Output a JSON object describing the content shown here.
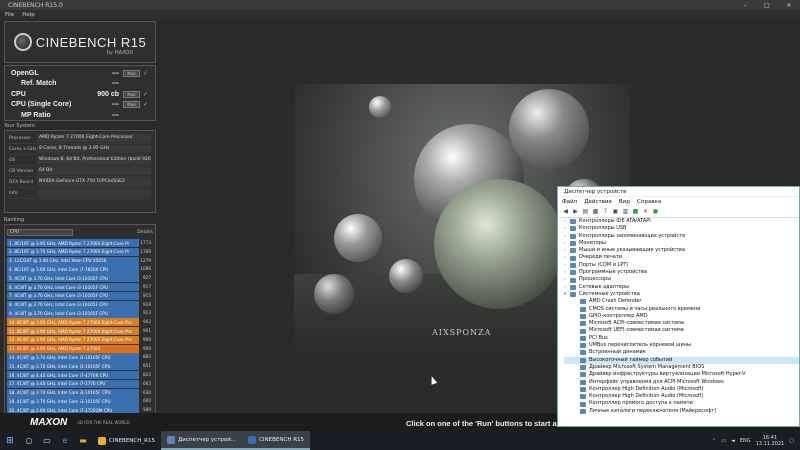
{
  "window": {
    "title": "CINEBENCH R15.0",
    "controls": [
      "–",
      "□",
      "✕"
    ]
  },
  "menu": [
    "File",
    "Help"
  ],
  "logo": {
    "name": "CINEBENCH R15",
    "by": "by MAXON"
  },
  "bench": [
    {
      "label": "OpenGL",
      "value": "---",
      "run": "Run",
      "check": "✓"
    },
    {
      "label": "Ref. Match",
      "value": "---"
    },
    {
      "label": "CPU",
      "value": "900 cb",
      "run": "Run",
      "check": "✓"
    },
    {
      "label": "CPU (Single Core)",
      "value": "---",
      "run": "Run",
      "check": "✓"
    },
    {
      "label": "MP Ratio",
      "value": "---"
    }
  ],
  "system": {
    "header": "Your System",
    "rows": [
      {
        "key": "Processor",
        "value": "AMD Ryzen 7 2700X Eight-Core Processor"
      },
      {
        "key": "Cores x GHz",
        "value": "8 Cores, 8 Threads @ 3.95 GHz"
      },
      {
        "key": "OS",
        "value": "Windows 8, 64 Bit, Professional Edition (build 9200)"
      },
      {
        "key": "CB Version",
        "value": "64 Bit"
      },
      {
        "key": "GFX Board",
        "value": "NVIDIA GeForce GTX 750 Ti/PCIe/SSE2"
      },
      {
        "key": "Info",
        "value": ""
      }
    ]
  },
  "ranking": {
    "header": "Ranking",
    "select": "CPU",
    "details": "Details",
    "rows": [
      {
        "desc": "1. 8C/16T @ 3.95 GHz, AMD Ryzen 7 2700X Eight-Core Pr",
        "score": "1773",
        "color": "#3a6fb0"
      },
      {
        "desc": "2. 8C/16T @ 3.70 GHz, AMD Ryzen 7 2700X Eight-Core Pr",
        "score": "1789",
        "color": "#3a6fb0"
      },
      {
        "desc": "3. 12C/24T @ 3.40 GHz, Intel Xeon CPU X5650",
        "score": "1279",
        "color": "#3a6fb0"
      },
      {
        "desc": "4. 8C/16T @ 3.60 GHz, Intel Core i7-7820X CPU",
        "score": "1086",
        "color": "#3a6fb0"
      },
      {
        "desc": "5. 4C/8T @ 3.70 GHz, Intel Core i3-10105F CPU",
        "score": "927",
        "color": "#3a6fb0"
      },
      {
        "desc": "6. 4C/8T @ 3.70 GHz, Intel Core i3-10105F CPU",
        "score": "917",
        "color": "#3a6fb0"
      },
      {
        "desc": "7. 4C/8T @ 3.70 GHz, Intel Core i3-10105F CPU",
        "score": "915",
        "color": "#3a6fb0"
      },
      {
        "desc": "8. 4C/8T @ 3.70 GHz, Intel Core i3-10105F CPU",
        "score": "916",
        "color": "#3a6fb0"
      },
      {
        "desc": "9. 4C/8T @ 3.70 GHz, Intel Core i3-10105F CPU",
        "score": "913",
        "color": "#3a6fb0"
      },
      {
        "desc": "10. 8C/8T @ 3.95 GHz, AMD Ryzen 7 2700X Eight-Core Pro",
        "score": "902",
        "color": "#d4801e"
      },
      {
        "desc": "11. 8C/8T @ 3.95 GHz, AMD Ryzen 7 2700X Eight-Core Pro",
        "score": "901",
        "color": "#d4801e"
      },
      {
        "desc": "12. 8C/8T @ 3.95 GHz, AMD Ryzen 7 2700X Eight-Core Pro",
        "score": "900",
        "color": "#d4801e"
      },
      {
        "desc": "13. 8C/8T @ 3.95 GHz, AMD Ryzen 7 2700X",
        "score": "900",
        "color": "#e2700e"
      },
      {
        "desc": "14. 4C/8T @ 3.70 GHz, Intel Core i3-10105F CPU",
        "score": "882",
        "color": "#3a6fb0"
      },
      {
        "desc": "15. 4C/8T @ 3.70 GHz, Intel Core i3-10105F CPU",
        "score": "851",
        "color": "#3a6fb0"
      },
      {
        "desc": "16. 4C/8T @ 4.40 GHz, Intel Core i7-4770K CPU",
        "score": "822",
        "color": "#3a6fb0"
      },
      {
        "desc": "17. 4C/8T @ 3.40 GHz, Intel Core i7-3770 CPU",
        "score": "662",
        "color": "#3a6fb0"
      },
      {
        "desc": "18. 4C/8T @ 3.70 GHz, Intel Core i3-10105F CPU",
        "score": "630",
        "color": "#3a6fb0"
      },
      {
        "desc": "19. 4C/8T @ 3.70 GHz, Intel Core i3-10105F CPU",
        "score": "600",
        "color": "#3a6fb0"
      },
      {
        "desc": "20. 4C/8T @ 2.60 GHz, Intel Core i7-3720QM CPU",
        "score": "590",
        "color": "#3a6fb0"
      },
      {
        "desc": "21. 4C/8T @ 2.79 GHz, Intel Core i7-3840QM CPU",
        "score": "505",
        "color": "#3a6fb0"
      }
    ],
    "legend": {
      "your_score": "Your Score",
      "identical": "Identical System",
      "your_color": "#d4801e",
      "identical_color": "#a0641e"
    }
  },
  "footer": {
    "brand": "MAXON",
    "slogan": "3D FOR THE REAL WORLD",
    "status": "Click on one of the 'Run' buttons to start a test."
  },
  "render": {
    "watermark": "AIXSPONZA"
  },
  "device_manager": {
    "title": "Диспетчер устройств",
    "menu": [
      "Файл",
      "Действие",
      "Вид",
      "Справка"
    ],
    "items": [
      {
        "label": "Контроллеры IDE ATA/ATAPI",
        "child": false
      },
      {
        "label": "Контроллеры USB",
        "child": false
      },
      {
        "label": "Контроллеры запоминающих устройств",
        "child": false
      },
      {
        "label": "Мониторы",
        "child": false
      },
      {
        "label": "Мыши и иные указывающие устройства",
        "child": false
      },
      {
        "label": "Очереди печати",
        "child": false
      },
      {
        "label": "Порты (COM и LPT)",
        "child": false
      },
      {
        "label": "Программные устройства",
        "child": false
      },
      {
        "label": "Процессоры",
        "child": false
      },
      {
        "label": "Сетевые адаптеры",
        "child": false
      },
      {
        "label": "Системные устройства",
        "child": false,
        "open": true
      },
      {
        "label": "AMD Crash Defender",
        "child": true
      },
      {
        "label": "CMOS системы и часы реального времени",
        "child": true
      },
      {
        "label": "GPIO-контроллер AMD",
        "child": true
      },
      {
        "label": "Microsoft ACPI-совместимая система",
        "child": true
      },
      {
        "label": "Microsoft UEFI-совместимая система",
        "child": true
      },
      {
        "label": "PCI Bus",
        "child": true
      },
      {
        "label": "UMBus перечислитель корневой шины",
        "child": true
      },
      {
        "label": "Встроенный динамик",
        "child": true
      },
      {
        "label": "Высокоточный таймер событий",
        "child": true,
        "selected": true
      },
      {
        "label": "Драйвер Microsoft System Management BIOS",
        "child": true
      },
      {
        "label": "Драйвер инфраструктуры виртуализации Microsoft Hyper-V",
        "child": true
      },
      {
        "label": "Интерфейс управления для ACPI Microsoft Windows",
        "child": true
      },
      {
        "label": "Контроллер High Definition Audio (Microsoft)",
        "child": true
      },
      {
        "label": "Контроллер High Definition Audio (Microsoft)",
        "child": true
      },
      {
        "label": "Контроллер прямого доступа к памяти",
        "child": true
      },
      {
        "label": "Личные каталоги переключателя (Майкрософт)",
        "child": true
      }
    ]
  },
  "taskbar": {
    "buttons": [
      {
        "label": "CINEBENCH_R15",
        "icon_color": "#e6b422",
        "active": false
      },
      {
        "label": "Диспетчер устрой...",
        "icon_color": "#5b86b5",
        "active": true
      },
      {
        "label": "CINEBENCH R15",
        "icon_color": "#3b6db3",
        "active": true
      }
    ],
    "lang": "ENG",
    "time": "16:41",
    "date": "13.11.2021"
  }
}
